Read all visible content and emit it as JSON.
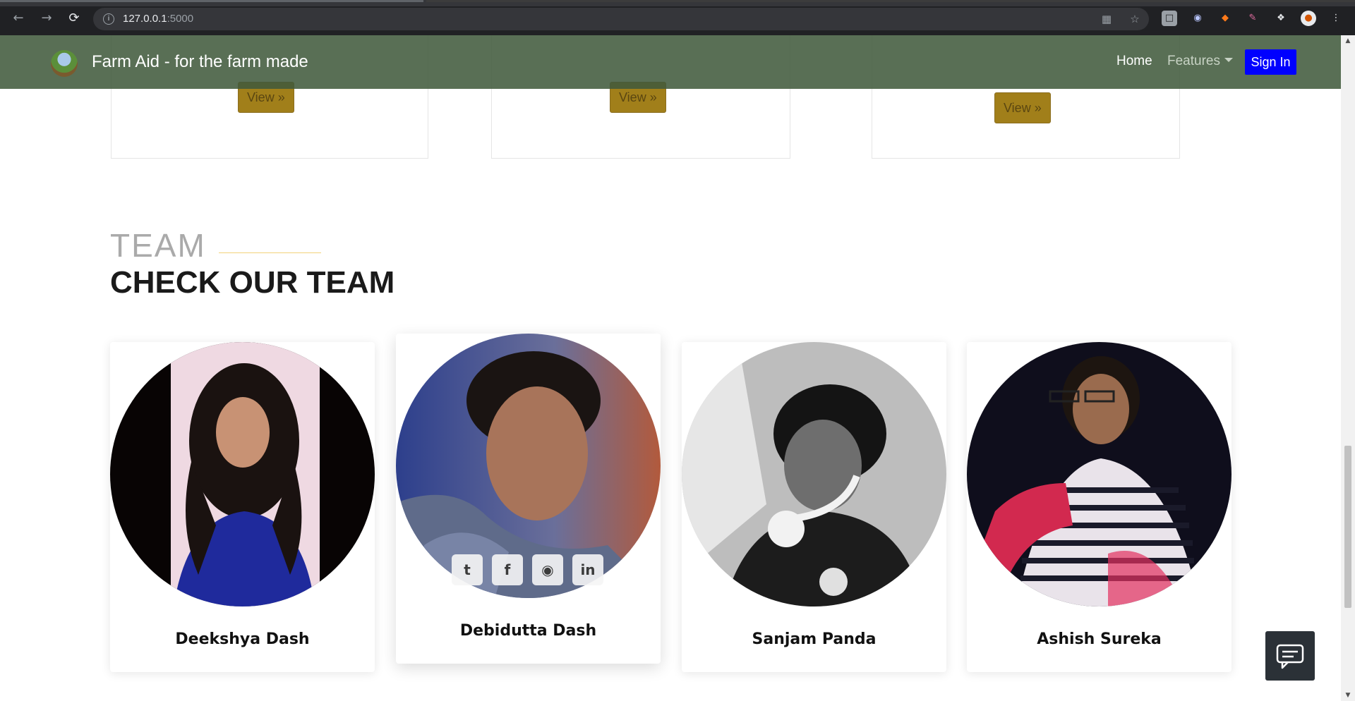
{
  "browser": {
    "url_host": "127.0.0.1",
    "url_port": ":5000",
    "back_icon": "arrow-left-icon",
    "forward_icon": "arrow-right-icon",
    "reload_icon": "reload-icon",
    "info_icon": "info-icon",
    "qr_icon": "qr-code-icon",
    "star_icon": "bookmark-star-icon",
    "menu_icon": "kebab-menu-icon"
  },
  "navbar": {
    "brand": "Farm Aid - for the farm made",
    "home": "Home",
    "features": "Features",
    "signin": "Sign In",
    "background": "#55705a",
    "signin_color": "#0000ff"
  },
  "feature_cards": {
    "view_labels": [
      "View »",
      "View »",
      "View »"
    ],
    "button_color": "#a17f1a"
  },
  "team": {
    "eyebrow": "TEAM",
    "title": "CHECK OUR TEAM",
    "members": [
      {
        "name": "Deekshya Dash"
      },
      {
        "name": "Debidutta Dash"
      },
      {
        "name": "Sanjam Panda"
      },
      {
        "name": "Ashish Sureka"
      }
    ],
    "social": [
      "twitter-icon",
      "facebook-icon",
      "instagram-icon",
      "linkedin-icon"
    ]
  },
  "chat": {
    "icon": "chat-bubble-icon"
  }
}
